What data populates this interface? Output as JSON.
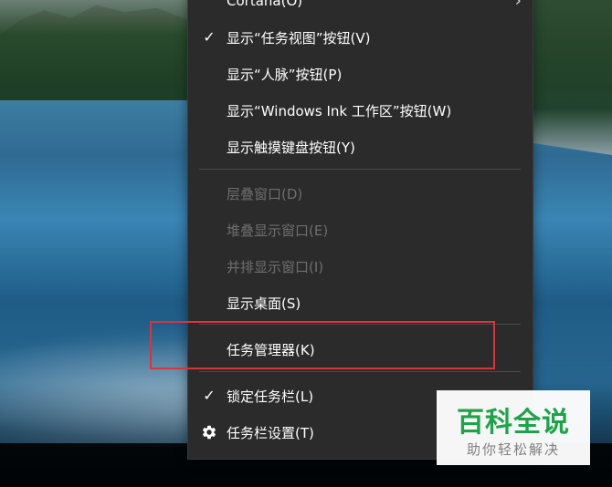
{
  "context_menu": {
    "items": [
      {
        "label": "Cortana(O)",
        "checked": false,
        "enabled": true,
        "has_submenu": true
      },
      {
        "label": "显示“任务视图”按钮(V)",
        "checked": true,
        "enabled": true
      },
      {
        "label": "显示“人脉”按钮(P)",
        "checked": false,
        "enabled": true
      },
      {
        "label": "显示“Windows Ink 工作区”按钮(W)",
        "checked": false,
        "enabled": true
      },
      {
        "label": "显示触摸键盘按钮(Y)",
        "checked": false,
        "enabled": true
      },
      {
        "label": "层叠窗口(D)",
        "checked": false,
        "enabled": false
      },
      {
        "label": "堆叠显示窗口(E)",
        "checked": false,
        "enabled": false
      },
      {
        "label": "并排显示窗口(I)",
        "checked": false,
        "enabled": false
      },
      {
        "label": "显示桌面(S)",
        "checked": false,
        "enabled": true
      },
      {
        "label": "任务管理器(K)",
        "checked": false,
        "enabled": true,
        "highlighted": true
      },
      {
        "label": "锁定任务栏(L)",
        "checked": true,
        "enabled": true
      },
      {
        "label": "任务栏设置(T)",
        "checked": false,
        "enabled": true,
        "icon": "gear-icon"
      }
    ],
    "check_glyph": "✓",
    "submenu_glyph": "›"
  },
  "watermark": {
    "title": "百科全说",
    "subtitle": "助你轻松解决",
    "title_color": "#1fa34a",
    "subtitle_color": "#7f7f7f"
  },
  "colors": {
    "menu_bg": "#2b2b2b",
    "menu_text": "#ffffff",
    "menu_disabled_text": "#6e6e6e",
    "highlight_border": "#d9343a"
  }
}
